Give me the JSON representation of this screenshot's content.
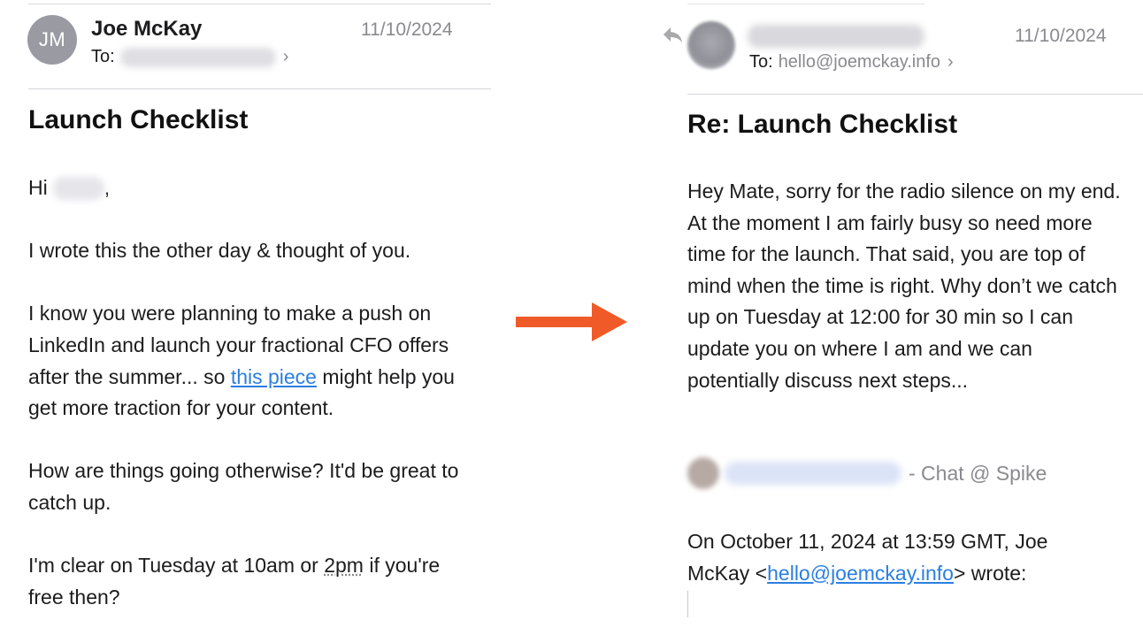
{
  "left_email": {
    "avatar_initials": "JM",
    "sender": "Joe McKay",
    "date": "11/10/2024",
    "to_label": "To:",
    "subject": "Launch Checklist",
    "greeting_start": "Hi",
    "greeting_end": ",",
    "para1": "I wrote this the other day & thought of you.",
    "para2_before": "I know you were planning to make a push on LinkedIn and launch your fractional CFO offers after the summer... so ",
    "para2_link": "this piece",
    "para2_after": " might help you get more traction for your content.",
    "para3": "How are things going otherwise? It'd be great to catch up.",
    "para4_before": "I'm clear on Tuesday at 10am or ",
    "para4_underlined": "2pm",
    "para4_after": " if you're free then?"
  },
  "right_email": {
    "date": "11/10/2024",
    "to_label": "To:",
    "to_address": "hello@joemckay.info",
    "subject": "Re: Launch Checklist",
    "body": "Hey Mate, sorry for the radio silence on my end. At the moment I am fairly busy so need more time for the launch. That said, you are top of mind when the time is right. Why don’t we catch up on Tuesday at 12:00 for 30 min so I can update you on where I am and we can potentially discuss next steps...",
    "signature_suffix": "- Chat @ Spike",
    "quote_before": "On October 11, 2024 at 13:59 GMT, Joe McKay <",
    "quote_email": "hello@joemckay.info",
    "quote_after": "> wrote:"
  },
  "colors": {
    "arrow": "#f05a28",
    "link": "#2b7fe0",
    "muted": "#8a8a8f"
  },
  "icons": {
    "chevron": "chevron-right-icon",
    "reply": "reply-icon",
    "arrow": "arrow-right-icon"
  }
}
